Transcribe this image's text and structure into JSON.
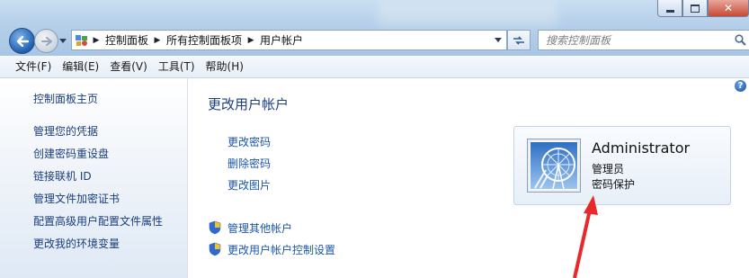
{
  "window": {
    "search_placeholder": "搜索控制面板"
  },
  "address_bar": {
    "crumbs": [
      "控制面板",
      "所有控制面板项",
      "用户帐户"
    ]
  },
  "menu": [
    "文件(F)",
    "编辑(E)",
    "查看(V)",
    "工具(T)",
    "帮助(H)"
  ],
  "sidebar": {
    "home": "控制面板主页",
    "items": [
      "管理您的凭据",
      "创建密码重设盘",
      "链接联机 ID",
      "管理文件加密证书",
      "配置高级用户配置文件属性",
      "更改我的环境变量"
    ]
  },
  "main": {
    "title": "更改用户帐户",
    "links": [
      "更改密码",
      "删除密码",
      "更改图片"
    ],
    "shield_links": [
      "管理其他帐户",
      "更改用户帐户控制设置"
    ]
  },
  "user": {
    "name": "Administrator",
    "role": "管理员",
    "protection": "密码保护"
  },
  "colors": {
    "link": "#1a56a8",
    "title": "#1c3f84",
    "arrow": "#e8282b"
  }
}
